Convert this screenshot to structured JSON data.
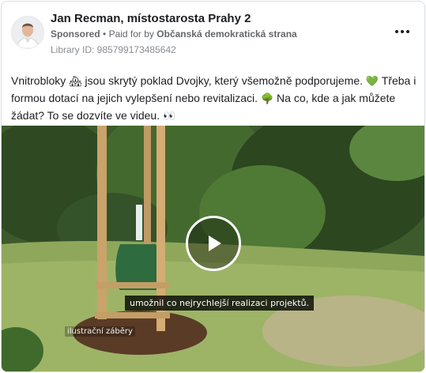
{
  "post": {
    "author": "Jan Recman, místostarosta Prahy 2",
    "sponsored_label": "Sponsored",
    "paid_prefix": "Paid for by",
    "payer": "Občanská demokratická strana",
    "library_id": "Library ID: 985799173485642",
    "text": {
      "t1": "Vnitrobloky ",
      "e1": "🏘",
      "t2": " jsou skrytý poklad Dvojky, který všemožně podporujeme. ",
      "e2": "💚",
      "t3": " Třeba i formou dotací na jejich vylepšení nebo revitalizaci. ",
      "e3": "🌳",
      "t4": " Na co, kde a jak můžete žádat? To se dozvíte ve videu. ",
      "e4": "👀"
    }
  },
  "video": {
    "subtitle": "umožnil co nejrychlejší realizaci projektů.",
    "watermark": "ilustrační záběry"
  },
  "icons": {
    "more": "more-horizontal-icon",
    "play": "play-icon"
  },
  "colors": {
    "text": "#1c1e21",
    "secondary": "#65676b",
    "border": "#dadde1"
  }
}
